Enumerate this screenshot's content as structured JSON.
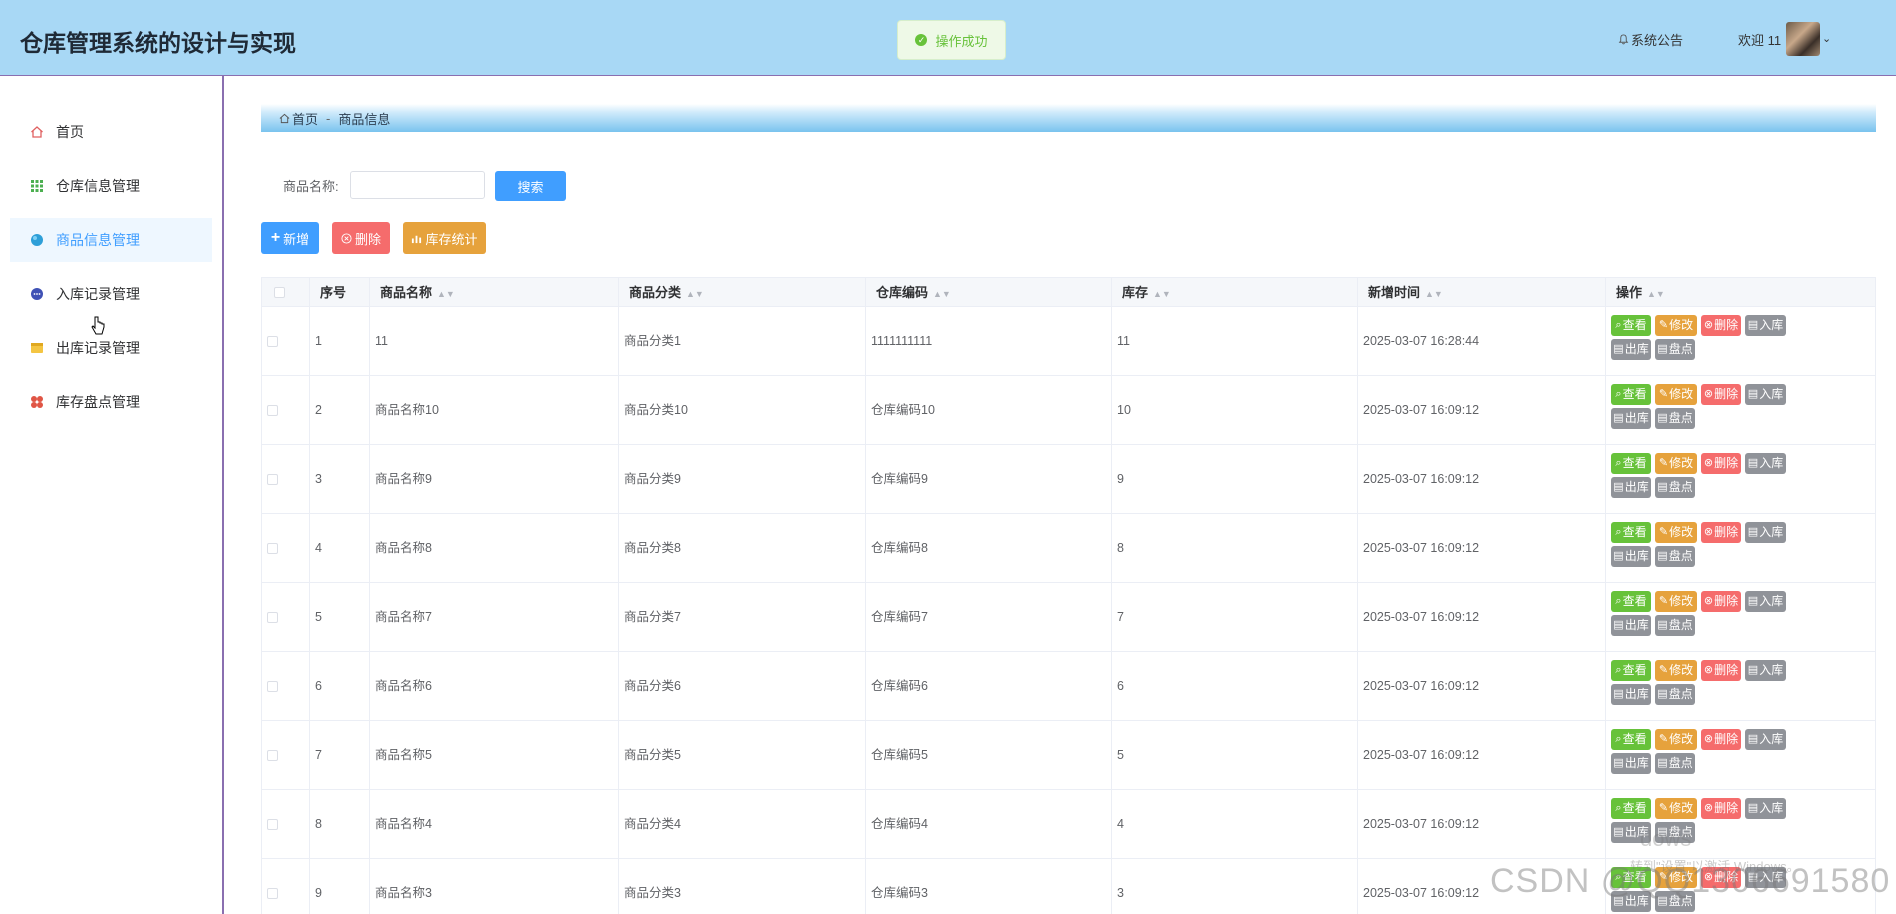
{
  "header": {
    "title": "仓库管理系统的设计与实现",
    "toast": "操作成功",
    "notice": "系统公告",
    "welcome": "欢迎 11"
  },
  "sidebar": {
    "items": [
      {
        "label": "首页",
        "icon": "home-icon"
      },
      {
        "label": "仓库信息管理",
        "icon": "grid-icon"
      },
      {
        "label": "商品信息管理",
        "icon": "circle-icon"
      },
      {
        "label": "入库记录管理",
        "icon": "dots-circle-icon"
      },
      {
        "label": "出库记录管理",
        "icon": "folder-icon"
      },
      {
        "label": "库存盘点管理",
        "icon": "flower-icon"
      }
    ]
  },
  "breadcrumb": {
    "home": "首页",
    "current": "商品信息"
  },
  "search": {
    "label": "商品名称:",
    "value": "",
    "placeholder": "",
    "button": "搜索"
  },
  "toolbar": {
    "add": "新增",
    "delete": "删除",
    "stats": "库存统计"
  },
  "table": {
    "headers": [
      "序号",
      "商品名称",
      "商品分类",
      "仓库编码",
      "库存",
      "新增时间",
      "操作"
    ],
    "rows": [
      {
        "idx": "1",
        "name": "11",
        "category": "商品分类1",
        "code": "1111111111",
        "stock": "11",
        "time": "2025-03-07 16:28:44"
      },
      {
        "idx": "2",
        "name": "商品名称10",
        "category": "商品分类10",
        "code": "仓库编码10",
        "stock": "10",
        "time": "2025-03-07 16:09:12"
      },
      {
        "idx": "3",
        "name": "商品名称9",
        "category": "商品分类9",
        "code": "仓库编码9",
        "stock": "9",
        "time": "2025-03-07 16:09:12"
      },
      {
        "idx": "4",
        "name": "商品名称8",
        "category": "商品分类8",
        "code": "仓库编码8",
        "stock": "8",
        "time": "2025-03-07 16:09:12"
      },
      {
        "idx": "5",
        "name": "商品名称7",
        "category": "商品分类7",
        "code": "仓库编码7",
        "stock": "7",
        "time": "2025-03-07 16:09:12"
      },
      {
        "idx": "6",
        "name": "商品名称6",
        "category": "商品分类6",
        "code": "仓库编码6",
        "stock": "6",
        "time": "2025-03-07 16:09:12"
      },
      {
        "idx": "7",
        "name": "商品名称5",
        "category": "商品分类5",
        "code": "仓库编码5",
        "stock": "5",
        "time": "2025-03-07 16:09:12"
      },
      {
        "idx": "8",
        "name": "商品名称4",
        "category": "商品分类4",
        "code": "仓库编码4",
        "stock": "4",
        "time": "2025-03-07 16:09:12"
      },
      {
        "idx": "9",
        "name": "商品名称3",
        "category": "商品分类3",
        "code": "仓库编码3",
        "stock": "3",
        "time": "2025-03-07 16:09:12"
      }
    ],
    "actions": {
      "view": "查看",
      "edit": "修改",
      "delete": "删除",
      "in": "入库",
      "out": "出库",
      "check": "盘点"
    }
  },
  "overlay": {
    "windows_line1": "dows",
    "windows_line2": "转到\"设置\"以激活 Windows。",
    "watermark": "CSDN @QQ1306691580"
  },
  "colors": {
    "header_bg": "#a8d8f5",
    "primary": "#409eff",
    "success": "#67c23a",
    "warning": "#e6a23c",
    "danger": "#f56c6c",
    "info": "#909399"
  }
}
